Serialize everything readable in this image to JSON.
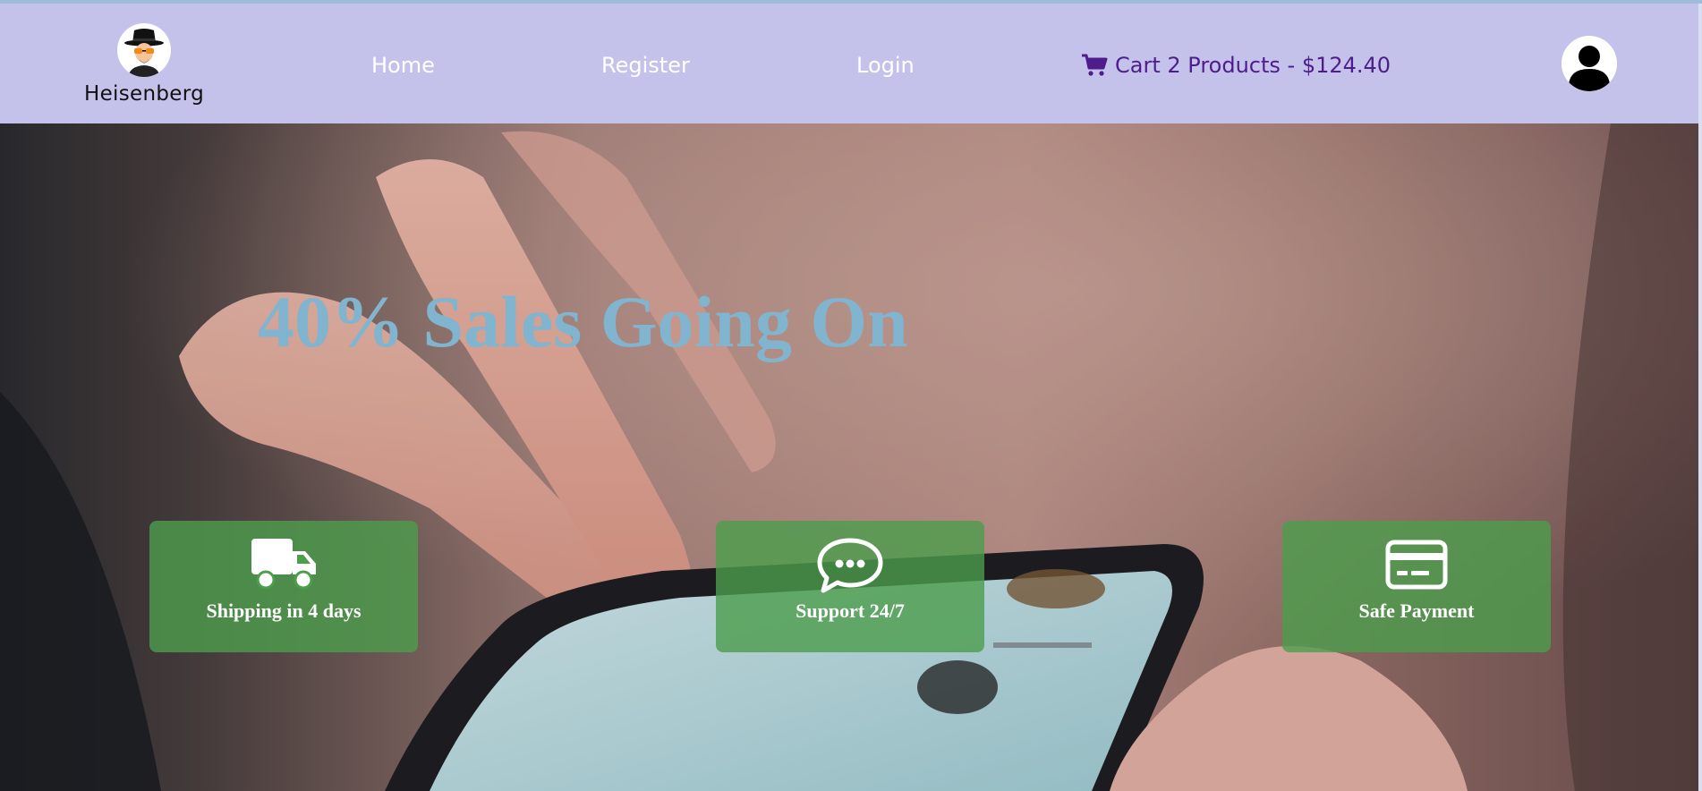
{
  "brand": {
    "name": "Heisenberg",
    "logo_icon": "heisenberg-logo-icon"
  },
  "nav": {
    "home": "Home",
    "register": "Register",
    "login": "Login"
  },
  "cart": {
    "icon": "cart-icon",
    "label": "Cart 2 Products - $124.40"
  },
  "user": {
    "icon": "user-avatar-icon"
  },
  "hero": {
    "title": "40% Sales Going On",
    "features": [
      {
        "icon": "truck-icon",
        "label": "Shipping in 4 days"
      },
      {
        "icon": "chat-bubble-icon",
        "label": "Support 24/7"
      },
      {
        "icon": "credit-card-icon",
        "label": "Safe Payment"
      }
    ]
  },
  "colors": {
    "navbar_bg": "#c4c2ea",
    "nav_link": "#ffffff",
    "cart_text": "#4e1d8b",
    "hero_title": "#80b4cf",
    "feature_bg": "#4c9e4c"
  }
}
